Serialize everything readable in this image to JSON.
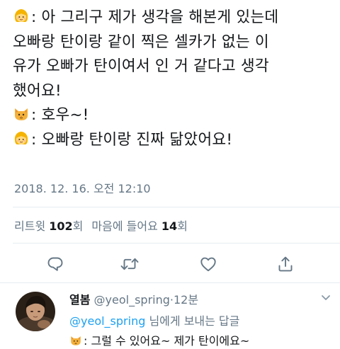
{
  "tweet": {
    "lines": [
      {
        "emoji": "girl-face-emoji",
        "text": ": 아 그리구 제가 생각을 해본게 있는데"
      },
      {
        "emoji": "",
        "text": "오빠랑 탄이랑 같이 찍은 셀카가 없는 이"
      },
      {
        "emoji": "",
        "text": "유가 오빠가 탄이여서 인 거 같다고 생각"
      },
      {
        "emoji": "",
        "text": "했어요!"
      },
      {
        "emoji": "cat-face-emoji",
        "text": ": 호우~!"
      },
      {
        "emoji": "girl-face-emoji",
        "text": ": 오빠랑 탄이랑 진짜 닮았어요!"
      }
    ],
    "timestamp": "2018. 12. 16. 오전 12:10",
    "stats": {
      "retweets_label": "리트윗",
      "retweets_count": "102",
      "retweets_unit": "회",
      "likes_label": "마음에 들어요",
      "likes_count": "14",
      "likes_unit": "회"
    },
    "actions": [
      "reply-icon",
      "retweet-icon",
      "like-icon",
      "share-icon"
    ]
  },
  "reply": {
    "name": "열봄",
    "handle": "@yeol_spring",
    "separator": "·",
    "time": "12분",
    "reply_to_handle": "@yeol_spring",
    "reply_to_suffix": " 님에게 보내는 답글",
    "text": ": 그럴 수 있어요~ 제가 탄이에요~",
    "text_emoji": "cat-face-emoji"
  },
  "colors": {
    "text": "#14171a",
    "secondary": "#657786",
    "accent": "#1da1f2",
    "divider": "#e6ecf0",
    "icon": "#657786"
  }
}
